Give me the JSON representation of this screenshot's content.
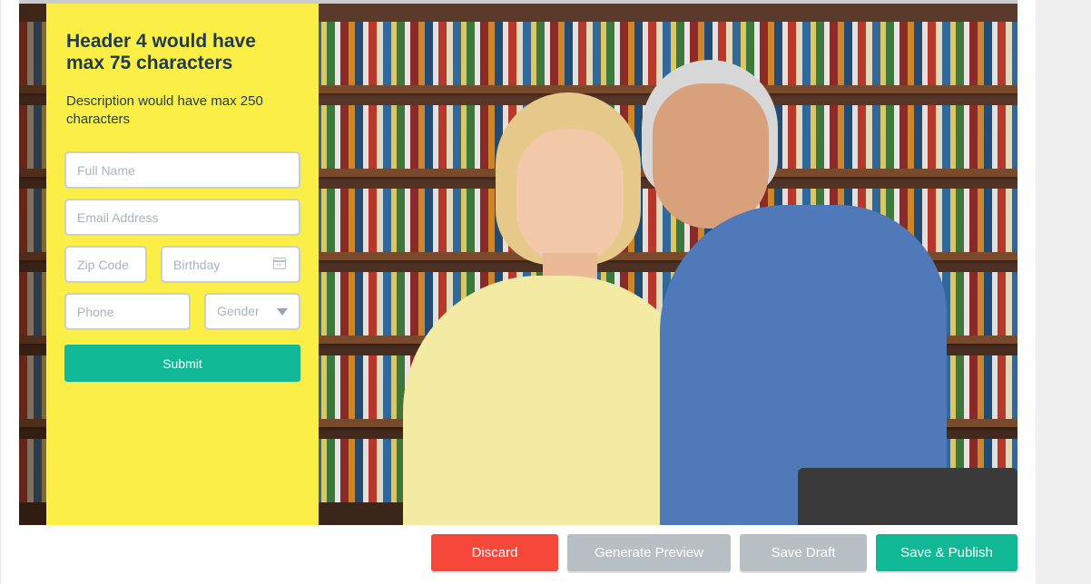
{
  "form": {
    "header": "Header 4 would have max 75 characters",
    "description": "Description would have max 250 characters",
    "fields": {
      "full_name_placeholder": "Full Name",
      "email_placeholder": "Email Address",
      "zip_placeholder": "Zip Code",
      "birthday_placeholder": "Birthday",
      "phone_placeholder": "Phone",
      "gender_selected": "Gender"
    },
    "submit_label": "Submit"
  },
  "actions": {
    "discard_label": "Discard",
    "preview_label": "Generate Preview",
    "save_draft_label": "Save Draft",
    "publish_label": "Save & Publish"
  },
  "icons": {
    "birthday": "calendar-icon",
    "gender": "chevron-down-icon"
  },
  "colors": {
    "panel_bg": "#fbee46",
    "accent_green": "#11b895",
    "discard_red": "#f5483b",
    "neutral_gray": "#b8bfc4",
    "header_text": "#1f3b4d"
  }
}
